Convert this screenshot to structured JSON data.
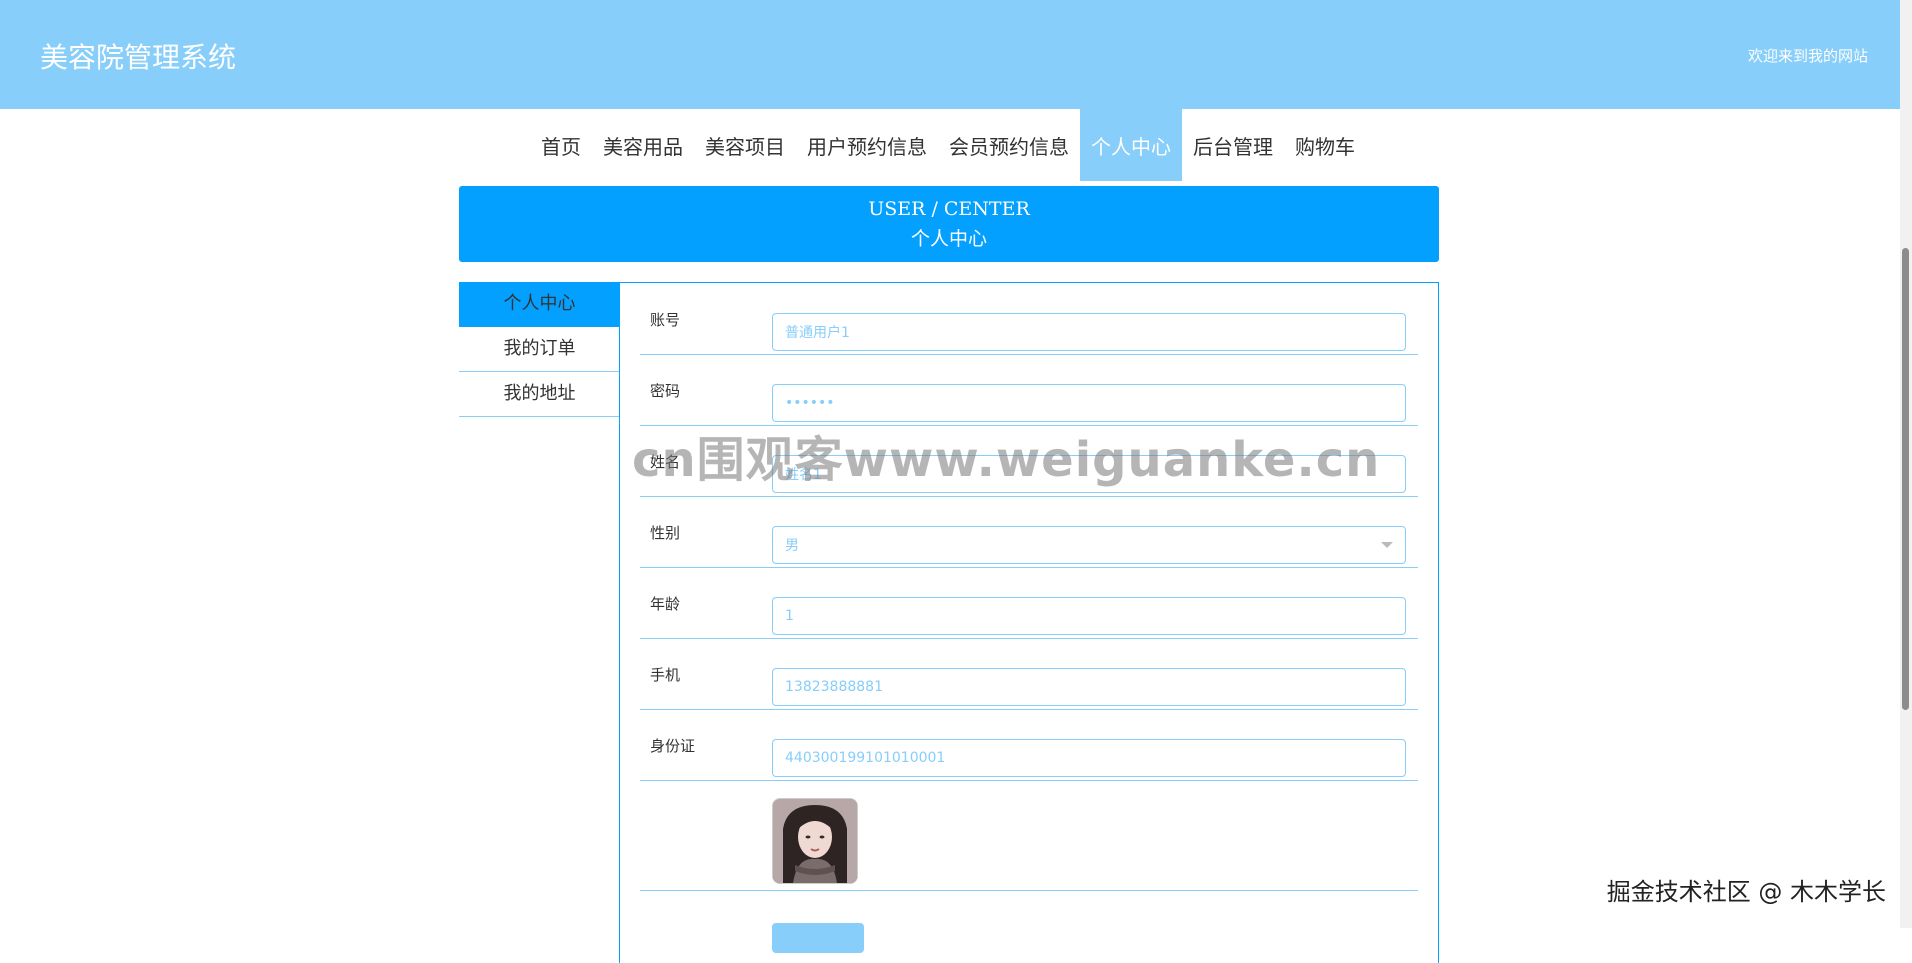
{
  "header": {
    "title": "美容院管理系统",
    "welcome": "欢迎来到我的网站"
  },
  "nav": {
    "items": [
      {
        "label": "首页"
      },
      {
        "label": "美容用品"
      },
      {
        "label": "美容项目"
      },
      {
        "label": "用户预约信息"
      },
      {
        "label": "会员预约信息"
      },
      {
        "label": "个人中心",
        "active": true
      },
      {
        "label": "后台管理"
      },
      {
        "label": "购物车"
      }
    ]
  },
  "banner": {
    "en": "USER / CENTER",
    "cn": "个人中心"
  },
  "side_menu": {
    "items": [
      {
        "label": "个人中心",
        "active": true
      },
      {
        "label": "我的订单"
      },
      {
        "label": "我的地址"
      }
    ]
  },
  "form": {
    "account": {
      "label": "账号",
      "value": "普通用户1"
    },
    "password": {
      "label": "密码",
      "value": "••••••"
    },
    "name": {
      "label": "姓名",
      "value": "姓名1"
    },
    "gender": {
      "label": "性别",
      "value": "男"
    },
    "age": {
      "label": "年龄",
      "value": "1"
    },
    "phone": {
      "label": "手机",
      "value": "13823888881"
    },
    "id_card": {
      "label": "身份证",
      "value": "440300199101010001"
    }
  },
  "watermark": "cn围观客www.weiguanke.cn",
  "credit": "掘金技术社区 @ 木木学长",
  "colors": {
    "header_bg": "#87cefa",
    "banner_bg": "#03a0ff",
    "accent": "#87cefa"
  }
}
